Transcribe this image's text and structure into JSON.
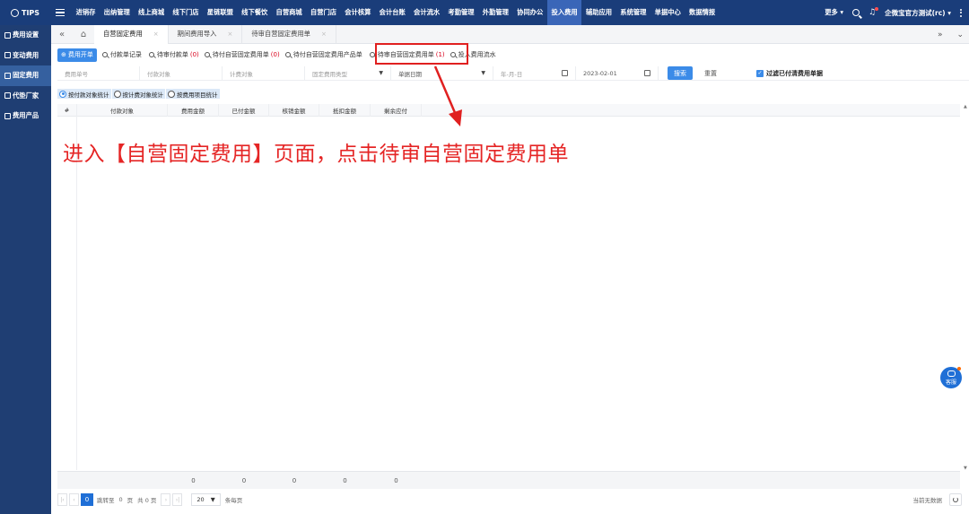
{
  "brand": "TIPS",
  "nav": {
    "items": [
      "进销存",
      "出纳管理",
      "线上商城",
      "线下门店",
      "星链联盟",
      "线下餐饮",
      "自营商城",
      "自营门店",
      "会计核算",
      "会计台账",
      "会计流水",
      "考勤管理",
      "外勤管理",
      "协同办公",
      "投入费用",
      "辅助应用",
      "系统管理",
      "单据中心",
      "数据情报"
    ],
    "active_index": 14,
    "more_label": "更多",
    "user_label": "企微宝官方测试(rc)"
  },
  "sidebar": {
    "items": [
      "费用设置",
      "变动费用",
      "固定费用",
      "代垫厂家",
      "费用产品"
    ],
    "active_index": 2
  },
  "tabs": {
    "items": [
      "自营固定费用",
      "期间费用导入",
      "待审自营固定费用单"
    ],
    "active_index": 0
  },
  "toolbar": {
    "primary_label": "费用开单",
    "buttons": [
      {
        "label": "付款单记录",
        "count": ""
      },
      {
        "label": "待审付款单",
        "count": "(0)"
      },
      {
        "label": "待付自营固定费用单",
        "count": "(0)"
      },
      {
        "label": "待付自营固定费用产品单",
        "count": ""
      },
      {
        "label": "待审自营固定费用单",
        "count": "(1)"
      },
      {
        "label": "投入费用流水",
        "count": ""
      }
    ]
  },
  "filters": {
    "bill_no_placeholder": "费用单号",
    "payee_placeholder": "付款对象",
    "charge_target_placeholder": "计费对象",
    "fee_type_placeholder": "固定费用类型",
    "date_type_value": "单据日期",
    "start_date_placeholder": "年-月-日",
    "end_date_value": "2023-02-01",
    "search_label": "搜索",
    "reset_label": "重置",
    "filter_checkbox_label": "过滤已付清费用单据"
  },
  "stat_modes": {
    "items": [
      "按付款对象统计",
      "按计费对象统计",
      "按费用项目统计"
    ],
    "selected_index": 0
  },
  "table": {
    "columns": [
      "#",
      "付款对象",
      "费用金额",
      "已付金额",
      "核销金额",
      "抵扣金额",
      "剩余应付"
    ],
    "totals": [
      "0",
      "0",
      "0",
      "0",
      "0"
    ]
  },
  "pagination": {
    "current_page": "0",
    "goto_label": "跳转至",
    "goto_value": "0",
    "page_unit": "页",
    "total_pages_text": "共 0 页",
    "page_size": "20",
    "page_size_suffix": "条每页",
    "no_data_text": "当前无数据"
  },
  "service_label": "客服",
  "annotation": {
    "instruction": "进入【自营固定费用】页面，点击待审自营固定费用单",
    "color": "#e52525"
  },
  "colors": {
    "topbar": "#1a3d7a",
    "sidebar": "#1f3e73",
    "primary": "#3b8be8",
    "highlight": "#e02020"
  }
}
